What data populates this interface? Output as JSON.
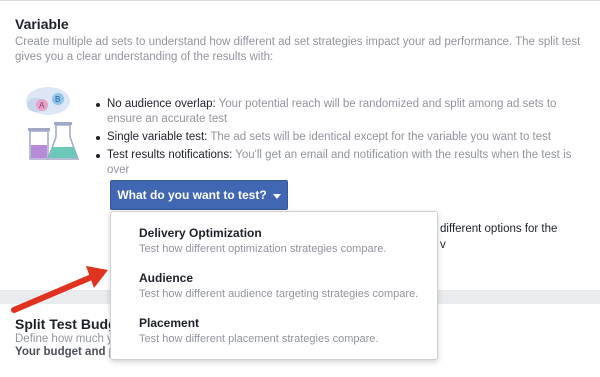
{
  "variable_section": {
    "title": "Variable",
    "description": "Create multiple ad sets to understand how different ad set strategies impact your ad performance. The split test gives you a clear understanding of the results with:",
    "bullets": [
      {
        "lead": "No audience overlap:",
        "text": " Your potential reach will be randomized and split among ad sets to ensure an accurate test"
      },
      {
        "lead": "Single variable test:",
        "text": " The ad sets will be identical except for the variable you want to test"
      },
      {
        "lead": "Test results notifications:",
        "text": " You'll get an email and notification with the results when the test is over"
      }
    ],
    "illustration_letters": {
      "a": "A",
      "b": "B"
    }
  },
  "test_button": {
    "label": "What do you want to test?"
  },
  "dropdown": {
    "options": [
      {
        "title": "Delivery Optimization",
        "description": "Test how different optimization strategies compare."
      },
      {
        "title": "Audience",
        "description": "Test how different audience targeting strategies compare."
      },
      {
        "title": "Placement",
        "description": "Test how different placement strategies compare."
      }
    ]
  },
  "obscured_text": {
    "left_fragment": "E",
    "right_line1": "different options for the",
    "right_line2": "v"
  },
  "budget_section": {
    "title": "Split Test Budge",
    "line1": "Define how much y",
    "line2": "Your budget and p"
  },
  "colors": {
    "button_blue": "#4267b2",
    "arrow_red": "#e0331f",
    "muted_text": "#90949c",
    "dark_text": "#1d2129"
  }
}
